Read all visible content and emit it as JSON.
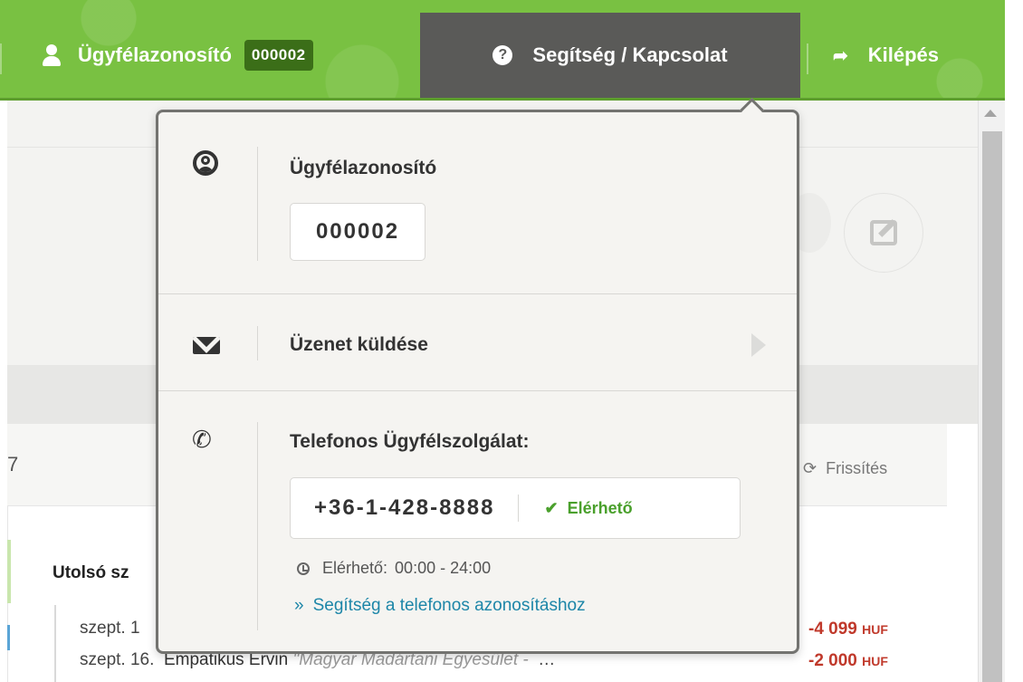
{
  "topbar": {
    "client_label": "Ügyfélazonosító",
    "client_id": "000002",
    "help_label": "Segítség / Kapcsolat",
    "help_icon": "?",
    "logout_label": "Kilépés",
    "logout_icon": "➦",
    "accent_color": "#79c142",
    "active_bg": "#5a5a58"
  },
  "popover": {
    "client_section": {
      "title": "Ügyfélazonosító",
      "value": "000002"
    },
    "message_section": {
      "title": "Üzenet küldése"
    },
    "phone_section": {
      "title": "Telefonos Ügyfélszolgálat:",
      "phone_icon": "✆",
      "number": "+36-1-428-8888",
      "status_icon": "✔",
      "status": "Elérhető",
      "hours_label": "Elérhető:",
      "hours_value": "00:00 - 24:00",
      "help_prefix": "»",
      "help_link": "Segítség a telefonos azonosításhoz"
    }
  },
  "background": {
    "number_fragment": "7",
    "refresh_icon": "⟳",
    "refresh_label": "Frissítés",
    "section_title": "Utolsó sz",
    "tx1_date": "szept. 1",
    "tx1_amount": "-4 099",
    "tx2_date": "szept. 16.",
    "tx2_payee": "Empatikus Ervin",
    "tx2_memo": "\"Magyar Madártani Egyesület -",
    "tx2_ellipsis": "…",
    "tx2_amount": "-2 000",
    "currency": "HUF"
  }
}
